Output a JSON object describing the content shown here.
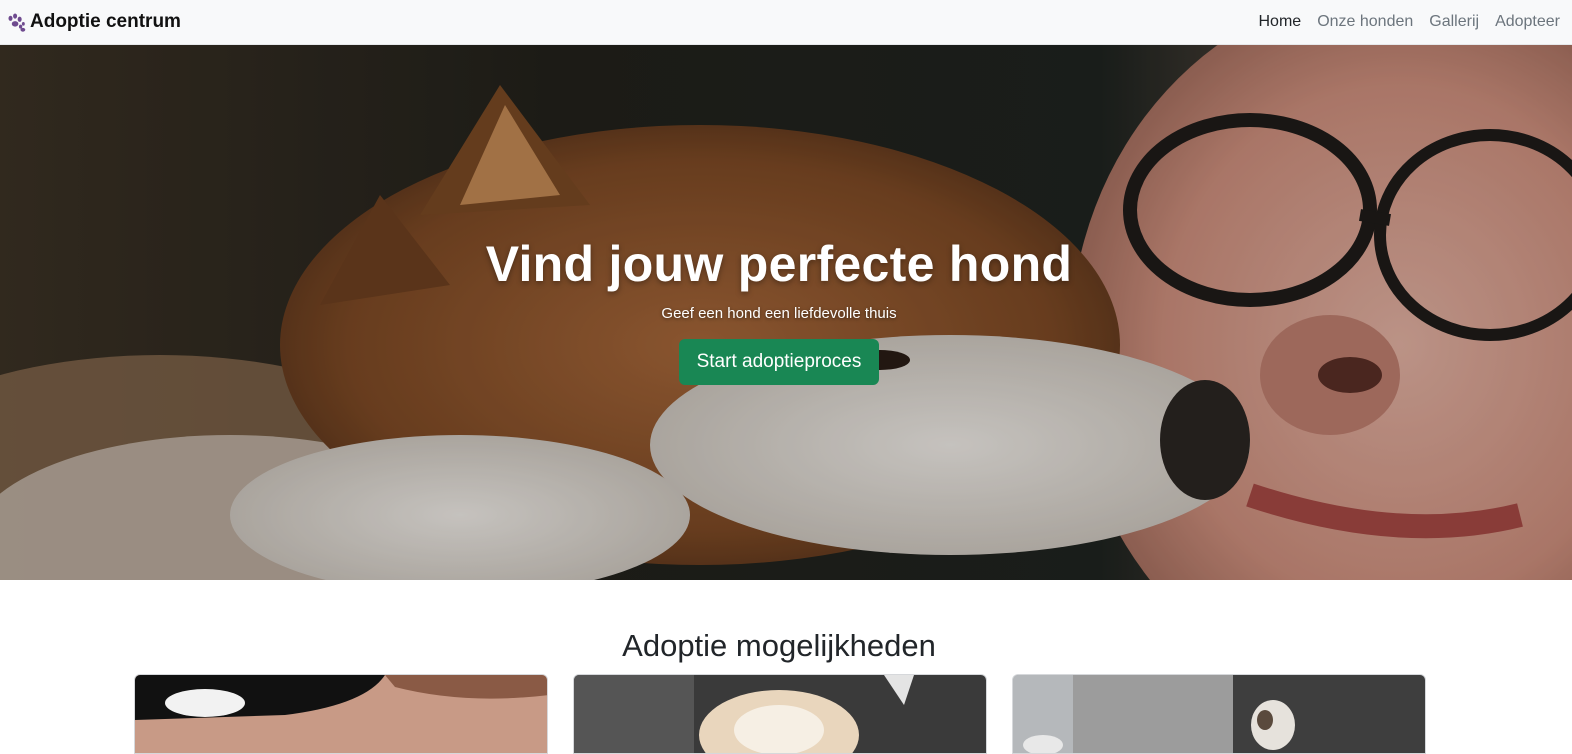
{
  "navbar": {
    "brand_icon": "paw-icon",
    "brand_label": "Adoptie centrum",
    "links": [
      {
        "label": "Home",
        "active": true
      },
      {
        "label": "Onze honden",
        "active": false
      },
      {
        "label": "Gallerij",
        "active": false
      },
      {
        "label": "Adopteer",
        "active": false
      }
    ]
  },
  "hero": {
    "title": "Vind jouw perfecte hond",
    "subtitle": "Geef een hond een liefdevolle thuis",
    "button_label": "Start adoptieproces",
    "button_color": "#198754"
  },
  "section": {
    "title": "Adoptie mogelijkheden"
  },
  "colors": {
    "navbar_bg": "#f8f9fa",
    "nav_active": "#212529",
    "nav_inactive": "#6c757d"
  }
}
